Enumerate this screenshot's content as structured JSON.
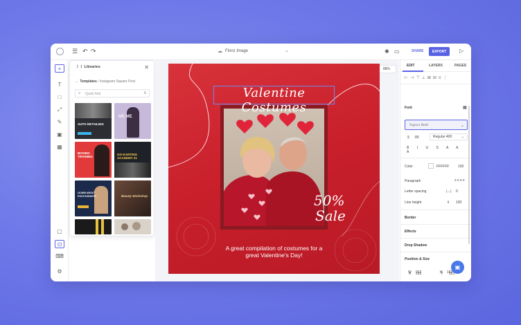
{
  "topbar": {
    "doc_title": "Flonz Image",
    "share_label": "SHARE",
    "export_label": "EXPORT"
  },
  "libraries": {
    "title": "Libraries",
    "crumb_root": "Templates",
    "crumb_sep": "/",
    "crumb_current": "Instagram Square Post",
    "search_placeholder": "Quick find",
    "thumbs": [
      {
        "label": "AUTO DETAILING",
        "bg": "#2b2d33"
      },
      {
        "label": "ME ME",
        "bg": "#c7b9d9"
      },
      {
        "label": "BOXING TRAINING",
        "bg": "#e23a3a"
      },
      {
        "label": "GO-KARTING ACADEMY 21",
        "bg": "#1f2128"
      },
      {
        "label": "LEARN ABOUT PHOTOGRAPHY",
        "bg": "#1b2a4a"
      },
      {
        "label": "Beauty Workshop",
        "bg": "#3a2a24"
      },
      {
        "label": "",
        "bg": "#1a1a1a"
      },
      {
        "label": "",
        "bg": "#d9d2c9"
      }
    ]
  },
  "canvas": {
    "zoom": "88%",
    "design": {
      "title": "Valentine Costumes",
      "sale_pct": "50%",
      "sale_word": "Sale",
      "caption_line1": "A great compilation of costumes for a",
      "caption_line2": "great Valentine's Day!"
    }
  },
  "panel": {
    "tabs": [
      "EDIT",
      "LAYERS",
      "PAGES"
    ],
    "font_label": "Font",
    "font_name": "Vujaxo Bold",
    "font_size": "80",
    "font_weight": "Regular 400",
    "color_label": "Color",
    "color_hex": "FFFFFF",
    "color_opacity": "100",
    "paragraph_label": "Paragraph",
    "letter_spacing_label": "Letter spacing",
    "letter_spacing_value": "0",
    "line_height_label": "Line height",
    "line_height_value": "100",
    "border_label": "Border",
    "effects_label": "Effects",
    "drop_shadow_label": "Drop Shadow",
    "position_label": "Position & Size",
    "x_label": "X",
    "x_value": "233",
    "y_label": "Y",
    "y_value": "113",
    "w_label": "W",
    "w_value": "917",
    "h_label": "H",
    "h_value": "163"
  },
  "colors": {
    "accent": "#5a62e4",
    "design_red": "#c81f2b"
  }
}
